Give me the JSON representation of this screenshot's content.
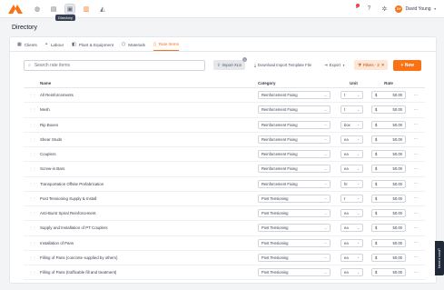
{
  "nav": {
    "tooltip": "Directory",
    "icons": [
      "home-icon",
      "clipboard-icon",
      "directory-icon",
      "document-icon",
      "chart-icon"
    ]
  },
  "user": {
    "initials": "DY",
    "name": "David Young"
  },
  "page": {
    "title": "Directory"
  },
  "tabs": [
    {
      "label": "Clients",
      "icon": "clients-icon"
    },
    {
      "label": "Labour",
      "icon": "labour-icon"
    },
    {
      "label": "Plant & Equipment",
      "icon": "plant-icon"
    },
    {
      "label": "Materials",
      "icon": "materials-icon"
    },
    {
      "label": "Rate Items",
      "icon": "rate-items-icon",
      "active": true
    }
  ],
  "toolbar": {
    "search_placeholder": "Search rate items",
    "import_label": "Import XLS",
    "import_badge": "i",
    "download_label": "Download Import Template File",
    "export_label": "Export",
    "filters_label": "Filters · 2",
    "new_label": "+ New"
  },
  "table": {
    "headers": {
      "name": "Name",
      "category": "Category",
      "unit": "Unit",
      "rate": "Rate"
    },
    "rows": [
      {
        "name": "All Reinforcements",
        "category": "Reinforcement Fixing",
        "unit": "t",
        "currency": "$",
        "rate": "50.00"
      },
      {
        "name": "Mesh",
        "category": "Reinforcement Fixing",
        "unit": "t",
        "currency": "$",
        "rate": "50.00"
      },
      {
        "name": "Rip Boxes",
        "category": "Reinforcement Fixing",
        "unit": "box",
        "currency": "$",
        "rate": "50.00"
      },
      {
        "name": "Shear Studs",
        "category": "Reinforcement Fixing",
        "unit": "ea",
        "currency": "$",
        "rate": "50.00"
      },
      {
        "name": "Couplers",
        "category": "Reinforcement Fixing",
        "unit": "ea",
        "currency": "$",
        "rate": "50.00"
      },
      {
        "name": "Screw-in Bars",
        "category": "Reinforcement Fixing",
        "unit": "ea",
        "currency": "$",
        "rate": "50.00"
      },
      {
        "name": "Transportation Offsite Prefabrication",
        "category": "Reinforcement Fixing",
        "unit": "hr",
        "currency": "$",
        "rate": "50.00"
      },
      {
        "name": "Post Tensioning Supply & Install",
        "category": "Post Tensioning",
        "unit": "t",
        "currency": "$",
        "rate": "50.00"
      },
      {
        "name": "Anti-Burst Spiral Reinforcement",
        "category": "Post Tensioning",
        "unit": "ea",
        "currency": "$",
        "rate": "50.00"
      },
      {
        "name": "Supply and Installation of PT Couplers",
        "category": "Post Tensioning",
        "unit": "ea",
        "currency": "$",
        "rate": "50.00"
      },
      {
        "name": "Installation of Pans",
        "category": "Post Tensioning",
        "unit": "ea",
        "currency": "$",
        "rate": "50.00"
      },
      {
        "name": "Filling of Pans (concrete supplied by others)",
        "category": "Post Tensioning",
        "unit": "ea",
        "currency": "$",
        "rate": "50.00"
      },
      {
        "name": "Filling of Pans (trafficable fill and treatment)",
        "category": "Post Tensioning",
        "unit": "ea",
        "currency": "$",
        "rate": "50.00"
      }
    ]
  },
  "feedback": {
    "label": "Need a hand?"
  },
  "colors": {
    "accent": "#f97316",
    "filters_bg": "#fde7d6"
  }
}
